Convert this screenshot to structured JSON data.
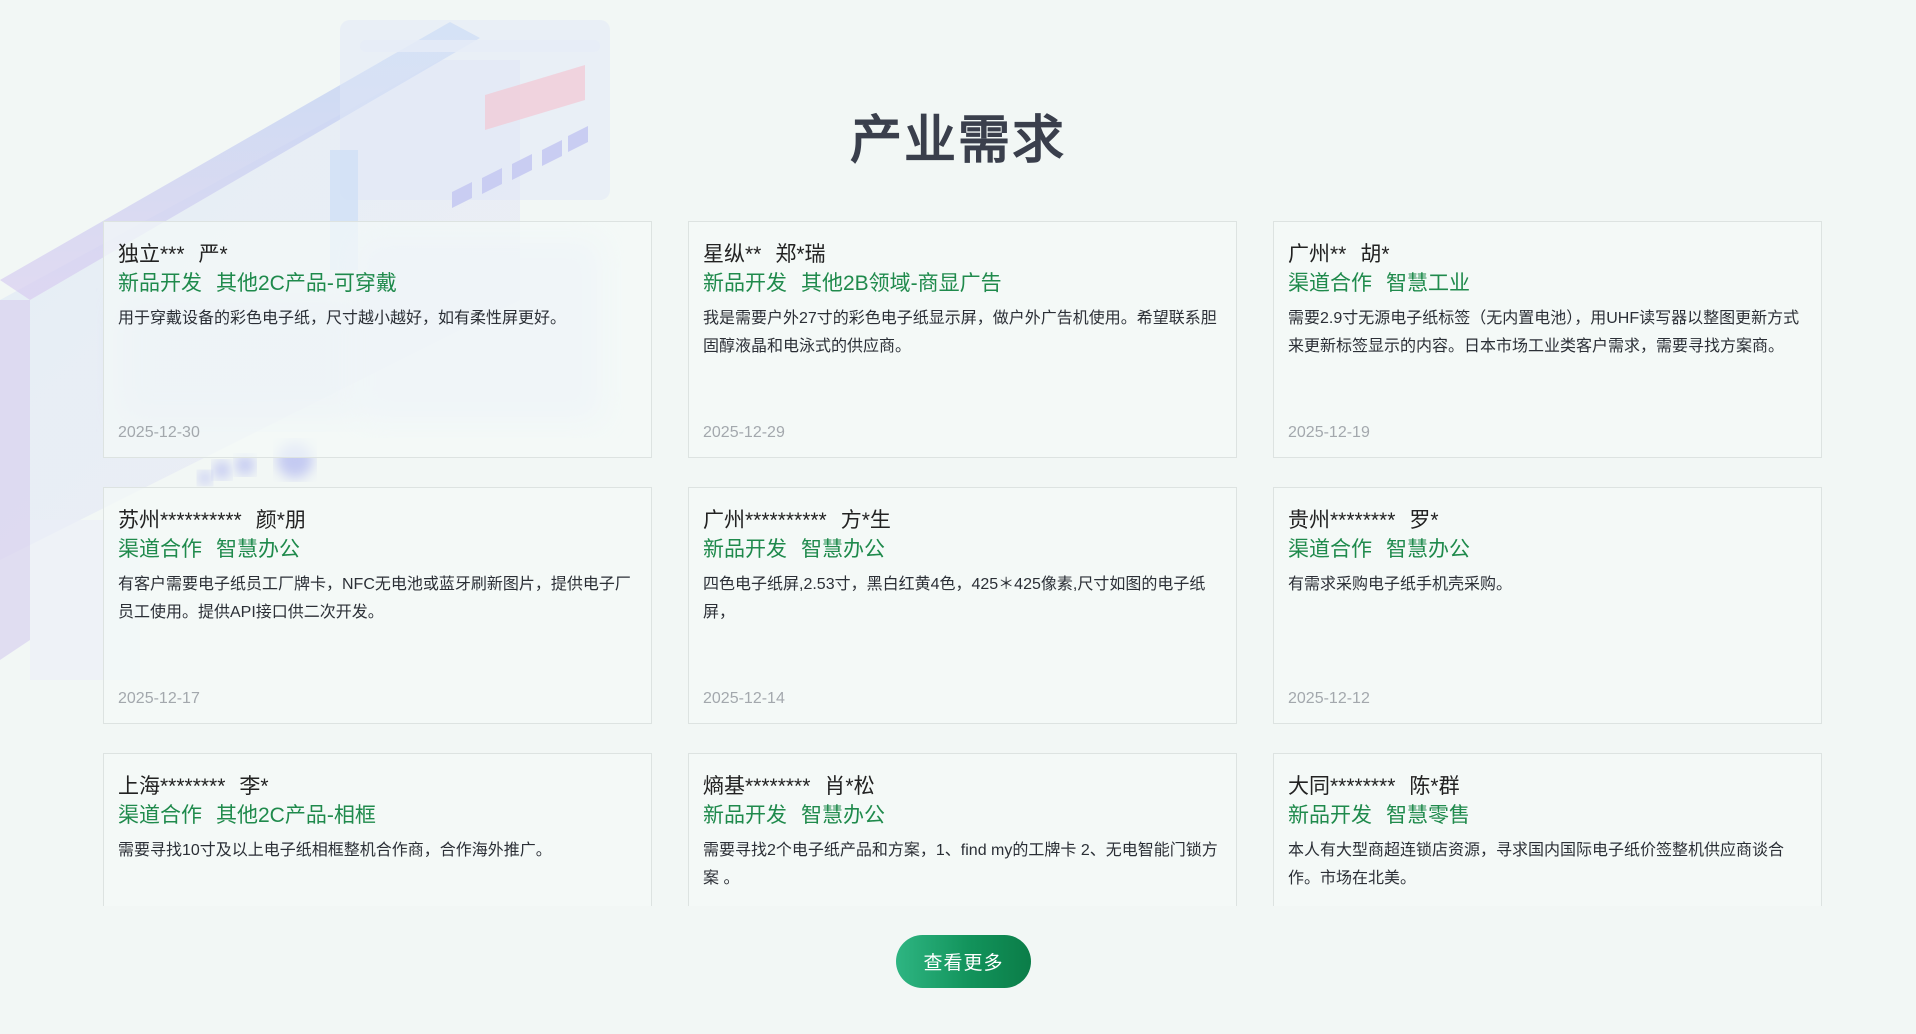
{
  "section": {
    "title": "产业需求",
    "more_label": "查看更多"
  },
  "cards": [
    {
      "company": "独立***",
      "name": "严*",
      "tag1": "新品开发",
      "tag2": "其他2C产品-可穿戴",
      "desc": "用于穿戴设备的彩色电子纸，尺寸越小越好，如有柔性屏更好。",
      "date": "2025-12-30"
    },
    {
      "company": "星纵**",
      "name": "郑*瑞",
      "tag1": "新品开发",
      "tag2": "其他2B领域-商显广告",
      "desc": "我是需要户外27寸的彩色电子纸显示屏，做户外广告机使用。希望联系胆固醇液晶和电泳式的供应商。",
      "date": "2025-12-29"
    },
    {
      "company": "广州**",
      "name": "胡*",
      "tag1": "渠道合作",
      "tag2": "智慧工业",
      "desc": "需要2.9寸无源电子纸标签（无内置电池），用UHF读写器以整图更新方式来更新标签显示的内容。日本市场工业类客户需求，需要寻找方案商。",
      "date": "2025-12-19"
    },
    {
      "company": "苏州**********",
      "name": "颜*朋",
      "tag1": "渠道合作",
      "tag2": "智慧办公",
      "desc": "有客户需要电子纸员工厂牌卡，NFC无电池或蓝牙刷新图片，提供电子厂员工使用。提供API接口供二次开发。",
      "date": "2025-12-17"
    },
    {
      "company": "广州**********",
      "name": "方*生",
      "tag1": "新品开发",
      "tag2": "智慧办公",
      "desc": "四色电子纸屏,2.53寸，黑白红黄4色，425＊425像素,尺寸如图的电子纸屏，",
      "date": "2025-12-14"
    },
    {
      "company": "贵州********",
      "name": "罗*",
      "tag1": "渠道合作",
      "tag2": "智慧办公",
      "desc": "有需求采购电子纸手机壳采购。",
      "date": "2025-12-12"
    },
    {
      "company": "上海********",
      "name": "李*",
      "tag1": "渠道合作",
      "tag2": "其他2C产品-相框",
      "desc": "需要寻找10寸及以上电子纸相框整机合作商，合作海外推广。",
      "date": ""
    },
    {
      "company": "熵基********",
      "name": "肖*松",
      "tag1": "新品开发",
      "tag2": "智慧办公",
      "desc": "需要寻找2个电子纸产品和方案，1、find my的工牌卡 2、无电智能门锁方案 。",
      "date": ""
    },
    {
      "company": "大同********",
      "name": "陈*群",
      "tag1": "新品开发",
      "tag2": "智慧零售",
      "desc": "本人有大型商超连锁店资源，寻求国内国际电子纸价签整机供应商谈合作。市场在北美。",
      "date": ""
    }
  ]
}
